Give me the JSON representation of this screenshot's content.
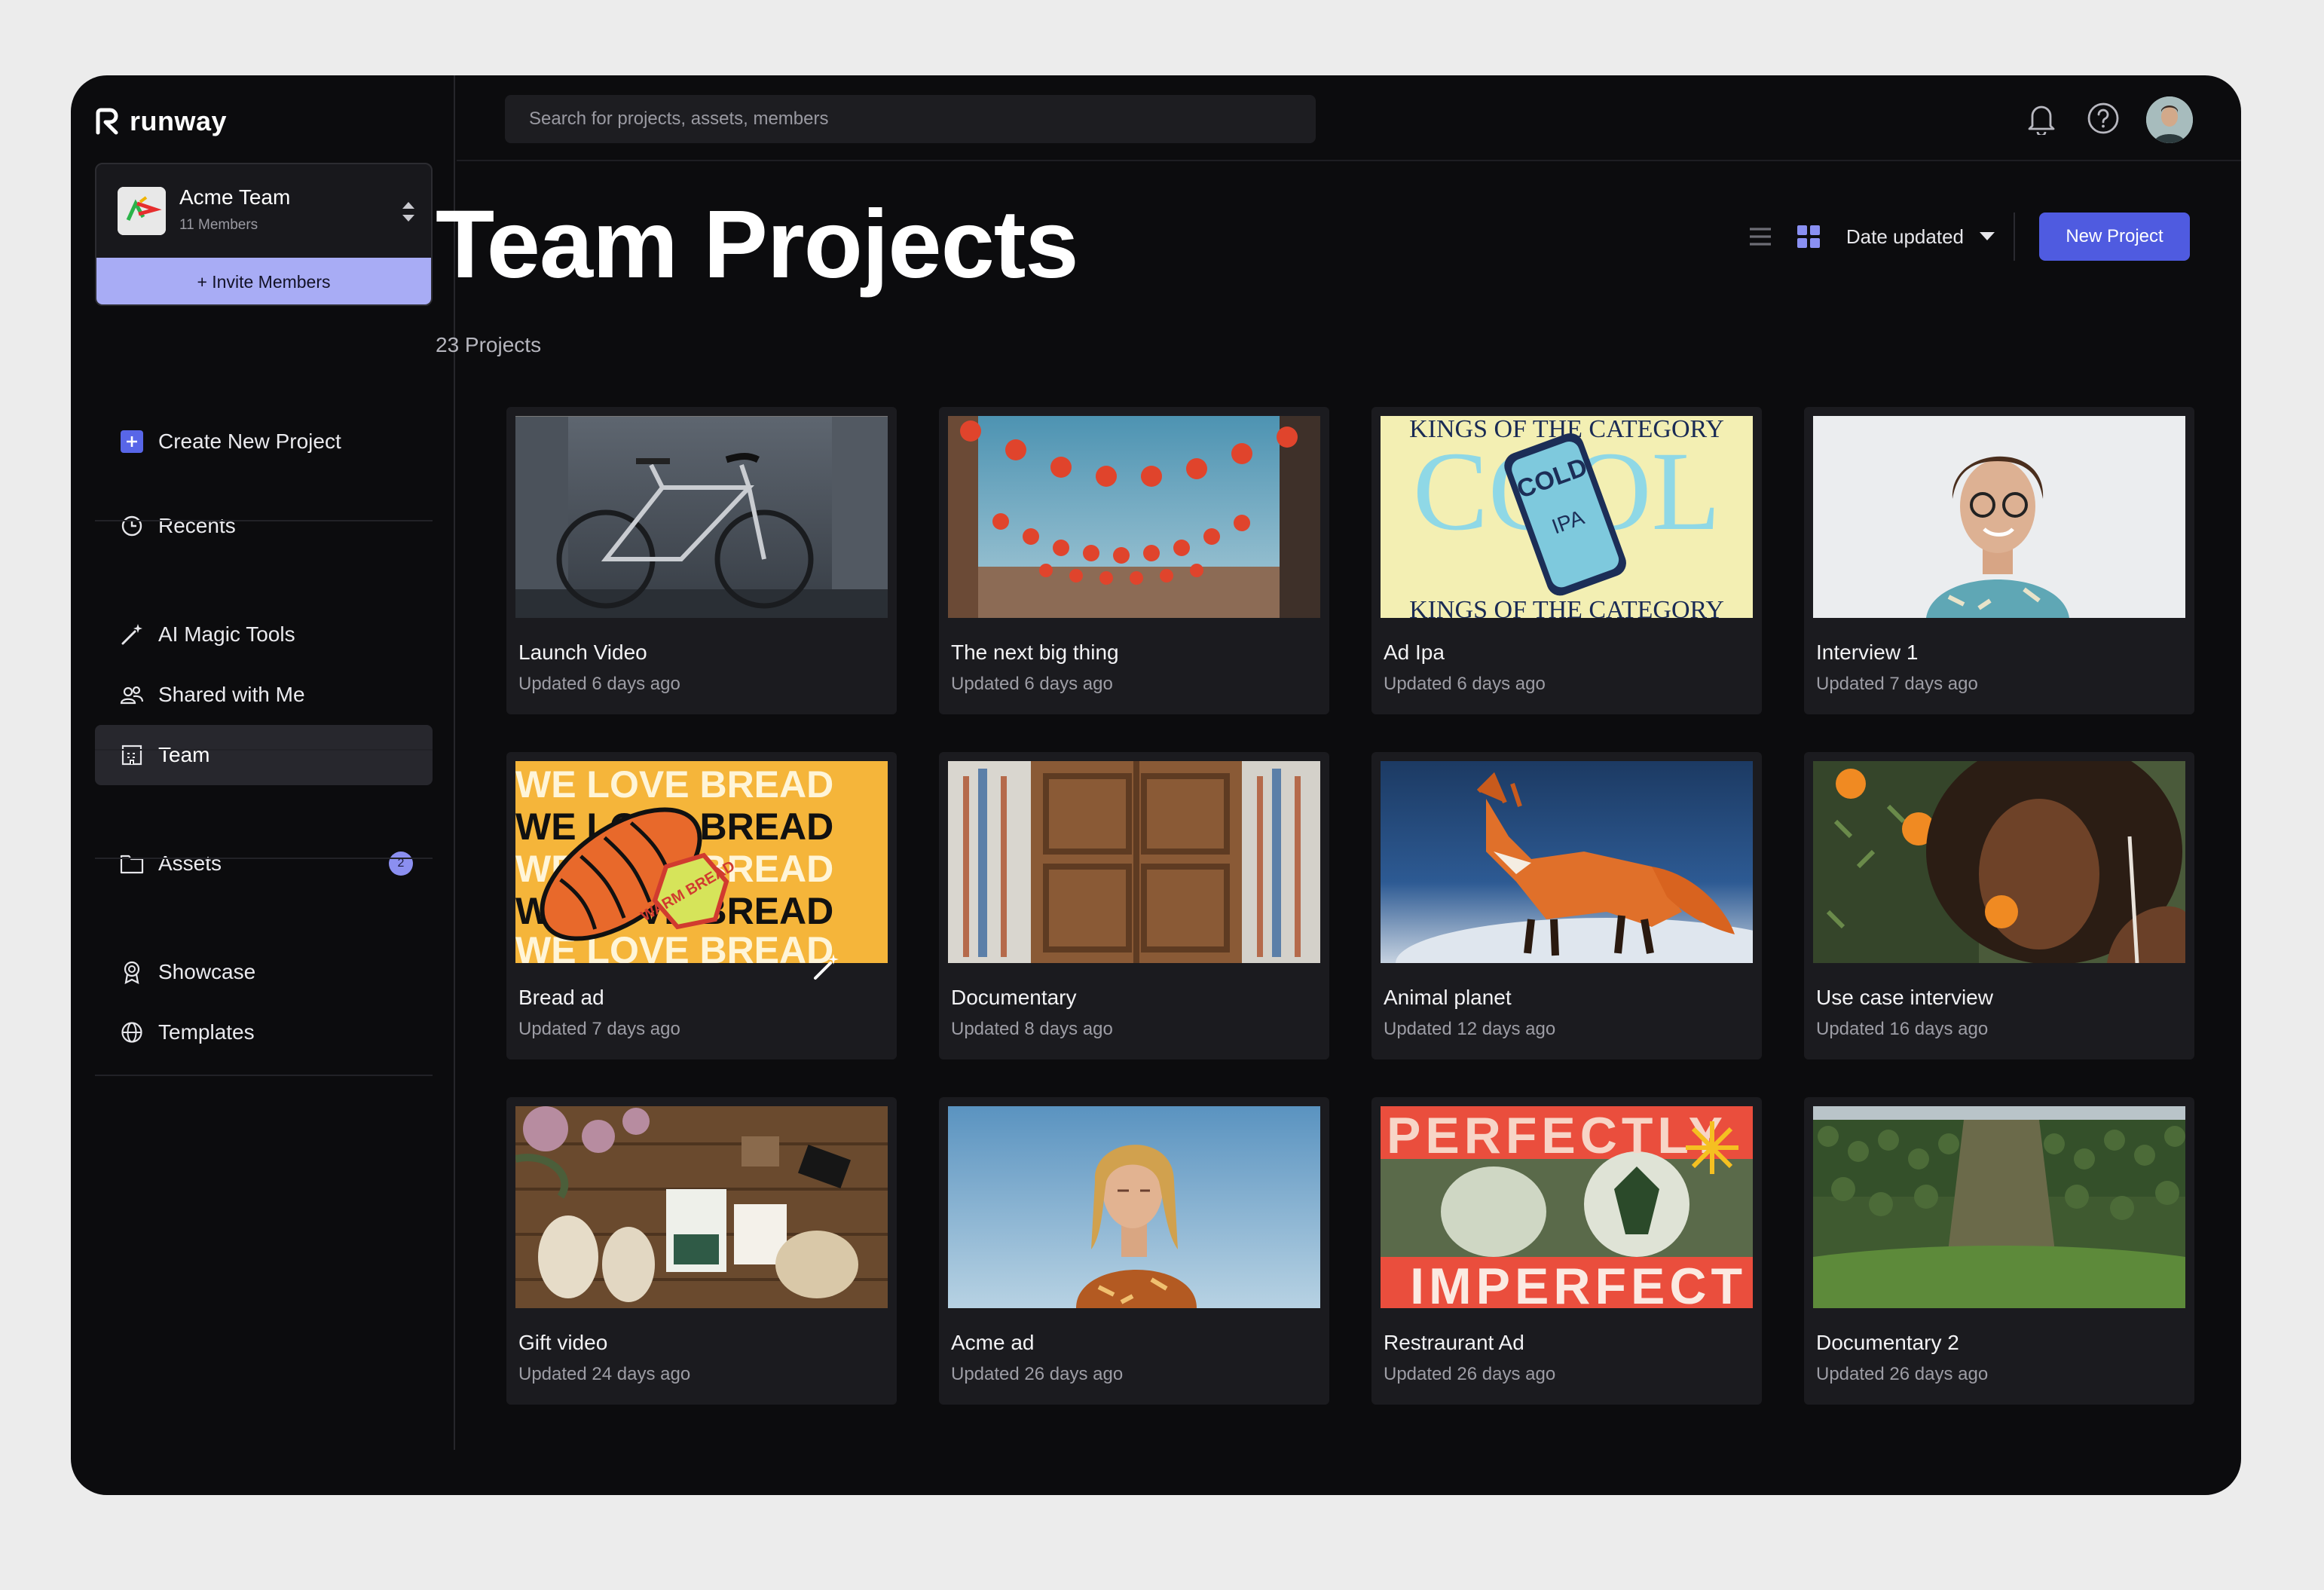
{
  "app": {
    "brand": "runway"
  },
  "team": {
    "name": "Acme Team",
    "members": "11 Members",
    "invite_label": "+ Invite Members"
  },
  "sidebar": {
    "items": [
      {
        "label": "Create New Project"
      },
      {
        "label": "Recents"
      },
      {
        "label": "AI Magic Tools"
      },
      {
        "label": "Shared with Me"
      },
      {
        "label": "Team"
      },
      {
        "label": "Assets",
        "badge": "2"
      },
      {
        "label": "Showcase"
      },
      {
        "label": "Templates"
      }
    ]
  },
  "search": {
    "placeholder": "Search for projects, assets, members"
  },
  "header": {
    "title": "Team Projects",
    "count": "23 Projects",
    "sort_label": "Date updated",
    "new_project_label": "New Project"
  },
  "colors": {
    "accent": "#4f5be0",
    "invite": "#a8acf5",
    "badge": "#8b8ff0"
  },
  "projects": [
    {
      "title": "Launch Video",
      "updated": "Updated 6 days ago"
    },
    {
      "title": "The next big thing",
      "updated": "Updated 6 days ago"
    },
    {
      "title": "Ad Ipa",
      "updated": "Updated 6 days ago",
      "thumb_text": {
        "top": "KINGS OF THE CATEGORY",
        "can": "COLD",
        "can2": "IPA"
      }
    },
    {
      "title": "Interview 1",
      "updated": "Updated 7 days ago"
    },
    {
      "title": "Bread ad",
      "updated": "Updated 7 days ago",
      "thumb_text": {
        "line": "WE LOVE BREAD",
        "badge": "WARM BREAD"
      }
    },
    {
      "title": "Documentary",
      "updated": "Updated 8 days ago"
    },
    {
      "title": "Animal planet",
      "updated": "Updated 12 days ago"
    },
    {
      "title": "Use case interview",
      "updated": "Updated 16 days ago"
    },
    {
      "title": "Gift video",
      "updated": "Updated 24 days ago"
    },
    {
      "title": "Acme ad",
      "updated": "Updated 26 days ago"
    },
    {
      "title": "Restraurant Ad",
      "updated": "Updated 26 days ago",
      "thumb_text": {
        "top": "PERFECTLY",
        "bottom": "IMPERFECT"
      }
    },
    {
      "title": "Documentary 2",
      "updated": "Updated 26 days ago"
    }
  ]
}
